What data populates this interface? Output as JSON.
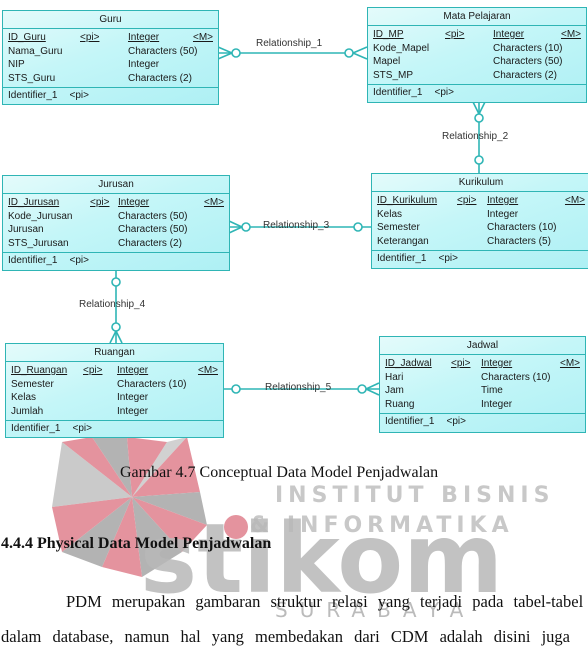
{
  "diagram": {
    "entities": [
      {
        "id": "guru",
        "title": "Guru",
        "attributes": [
          {
            "name": "ID_Guru",
            "pi": "<pi>",
            "type": "Integer",
            "mandatory": "<M>",
            "key": true
          },
          {
            "name": "Nama_Guru",
            "pi": "",
            "type": "Characters (50)",
            "mandatory": "",
            "key": false
          },
          {
            "name": "NIP",
            "pi": "",
            "type": "Integer",
            "mandatory": "",
            "key": false
          },
          {
            "name": "STS_Guru",
            "pi": "",
            "type": "Characters (2)",
            "mandatory": "",
            "key": false
          }
        ],
        "identifier": {
          "name": "Identifier_1",
          "pi": "<pi>"
        }
      },
      {
        "id": "mata_pelajaran",
        "title": "Mata Pelajaran",
        "attributes": [
          {
            "name": "ID_MP",
            "pi": "<pi>",
            "type": "Integer",
            "mandatory": "<M>",
            "key": true
          },
          {
            "name": "Kode_Mapel",
            "pi": "",
            "type": "Characters (10)",
            "mandatory": "",
            "key": false
          },
          {
            "name": "Mapel",
            "pi": "",
            "type": "Characters (50)",
            "mandatory": "",
            "key": false
          },
          {
            "name": "STS_MP",
            "pi": "",
            "type": "Characters (2)",
            "mandatory": "",
            "key": false
          }
        ],
        "identifier": {
          "name": "Identifier_1",
          "pi": "<pi>"
        }
      },
      {
        "id": "jurusan",
        "title": "Jurusan",
        "attributes": [
          {
            "name": "ID_Jurusan",
            "pi": "<pi>",
            "type": "Integer",
            "mandatory": "<M>",
            "key": true
          },
          {
            "name": "Kode_Jurusan",
            "pi": "",
            "type": "Characters (50)",
            "mandatory": "",
            "key": false
          },
          {
            "name": "Jurusan",
            "pi": "",
            "type": "Characters (50)",
            "mandatory": "",
            "key": false
          },
          {
            "name": "STS_Jurusan",
            "pi": "",
            "type": "Characters (2)",
            "mandatory": "",
            "key": false
          }
        ],
        "identifier": {
          "name": "Identifier_1",
          "pi": "<pi>"
        }
      },
      {
        "id": "kurikulum",
        "title": "Kurikulum",
        "attributes": [
          {
            "name": "ID_Kurikulum",
            "pi": "<pi>",
            "type": "Integer",
            "mandatory": "<M>",
            "key": true
          },
          {
            "name": "Kelas",
            "pi": "",
            "type": "Integer",
            "mandatory": "",
            "key": false
          },
          {
            "name": "Semester",
            "pi": "",
            "type": "Characters (10)",
            "mandatory": "",
            "key": false
          },
          {
            "name": "Keterangan",
            "pi": "",
            "type": "Characters (5)",
            "mandatory": "",
            "key": false
          }
        ],
        "identifier": {
          "name": "Identifier_1",
          "pi": "<pi>"
        }
      },
      {
        "id": "ruangan",
        "title": "Ruangan",
        "attributes": [
          {
            "name": "ID_Ruangan",
            "pi": "<pi>",
            "type": "Integer",
            "mandatory": "<M>",
            "key": true
          },
          {
            "name": "Semester",
            "pi": "",
            "type": "Characters (10)",
            "mandatory": "",
            "key": false
          },
          {
            "name": "Kelas",
            "pi": "",
            "type": "Integer",
            "mandatory": "",
            "key": false
          },
          {
            "name": "Jumlah",
            "pi": "",
            "type": "Integer",
            "mandatory": "",
            "key": false
          }
        ],
        "identifier": {
          "name": "Identifier_1",
          "pi": "<pi>"
        }
      },
      {
        "id": "jadwal",
        "title": "Jadwal",
        "attributes": [
          {
            "name": "ID_Jadwal",
            "pi": "<pi>",
            "type": "Integer",
            "mandatory": "<M>",
            "key": true
          },
          {
            "name": "Hari",
            "pi": "",
            "type": "Characters (10)",
            "mandatory": "",
            "key": false
          },
          {
            "name": "Jam",
            "pi": "",
            "type": "Time",
            "mandatory": "",
            "key": false
          },
          {
            "name": "Ruang",
            "pi": "",
            "type": "Integer",
            "mandatory": "",
            "key": false
          }
        ],
        "identifier": {
          "name": "Identifier_1",
          "pi": "<pi>"
        }
      }
    ],
    "relationships": [
      {
        "label": "Relationship_1",
        "from": "guru",
        "to": "mata_pelajaran",
        "from_card": "many",
        "to_card": "many"
      },
      {
        "label": "Relationship_2",
        "from": "mata_pelajaran",
        "to": "kurikulum",
        "from_card": "many",
        "to_card": "one"
      },
      {
        "label": "Relationship_3",
        "from": "jurusan",
        "to": "kurikulum",
        "from_card": "many",
        "to_card": "one"
      },
      {
        "label": "Relationship_4",
        "from": "jurusan",
        "to": "ruangan",
        "from_card": "one",
        "to_card": "many"
      },
      {
        "label": "Relationship_5",
        "from": "ruangan",
        "to": "jadwal",
        "from_card": "one",
        "to_card": "many"
      }
    ],
    "colors": {
      "line": "#2fb5b5",
      "fill": "#c4f6f8"
    }
  },
  "document": {
    "caption": "Gambar 4.7 Conceptual Data Model Penjadwalan",
    "heading": "4.4.4 Physical Data Model Penjadwalan",
    "paragraph_line1": "PDM merupakan gambaran struktur relasi yang terjadi pada tabel-tabel",
    "paragraph_line2": "dalam database, namun hal yang membedakan dari CDM adalah disini juga"
  },
  "watermark": {
    "line1": "INSTITUT BISNIS",
    "line2": "& INFORMATIKA",
    "brand": "stikom",
    "line3": "SURABAYA",
    "colors": {
      "pink": "#e4939e",
      "grey": "#b3b3b3"
    }
  }
}
